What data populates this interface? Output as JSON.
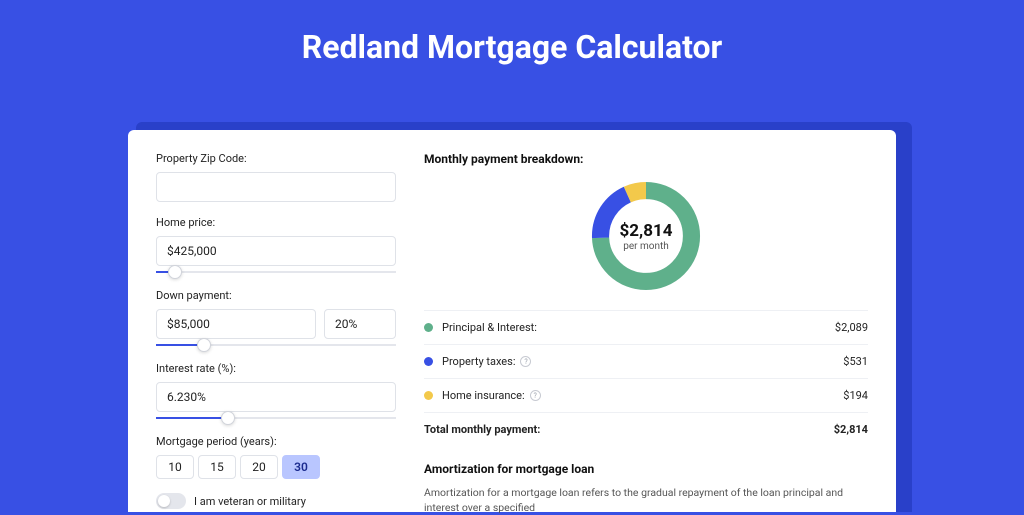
{
  "page": {
    "title": "Redland Mortgage Calculator"
  },
  "form": {
    "zip_label": "Property Zip Code:",
    "zip_value": "",
    "home_price_label": "Home price:",
    "home_price_value": "$425,000",
    "home_price_slider_pct": 8,
    "down_payment_label": "Down payment:",
    "down_payment_value": "$85,000",
    "down_payment_pct": "20%",
    "down_payment_slider_pct": 20,
    "interest_label": "Interest rate (%):",
    "interest_value": "6.230%",
    "interest_slider_pct": 30,
    "period_label": "Mortgage period (years):",
    "periods": [
      "10",
      "15",
      "20",
      "30"
    ],
    "period_selected": "30",
    "veteran_label": "I am veteran or military"
  },
  "breakdown": {
    "title": "Monthly payment breakdown:",
    "center_amount": "$2,814",
    "center_sub": "per month",
    "items": [
      {
        "label": "Principal & Interest:",
        "value": "$2,089",
        "color": "#5fb08b",
        "help": false
      },
      {
        "label": "Property taxes:",
        "value": "$531",
        "color": "#3850e4",
        "help": true
      },
      {
        "label": "Home insurance:",
        "value": "$194",
        "color": "#f3c94b",
        "help": true
      }
    ],
    "total_label": "Total monthly payment:",
    "total_value": "$2,814"
  },
  "amort": {
    "title": "Amortization for mortgage loan",
    "body": "Amortization for a mortgage loan refers to the gradual repayment of the loan principal and interest over a specified"
  },
  "chart_data": {
    "type": "pie",
    "title": "Monthly payment breakdown",
    "series": [
      {
        "name": "Principal & Interest",
        "value": 2089,
        "color": "#5fb08b"
      },
      {
        "name": "Property taxes",
        "value": 531,
        "color": "#3850e4"
      },
      {
        "name": "Home insurance",
        "value": 194,
        "color": "#f3c94b"
      }
    ],
    "total": 2814,
    "center_label": "$2,814 per month"
  }
}
